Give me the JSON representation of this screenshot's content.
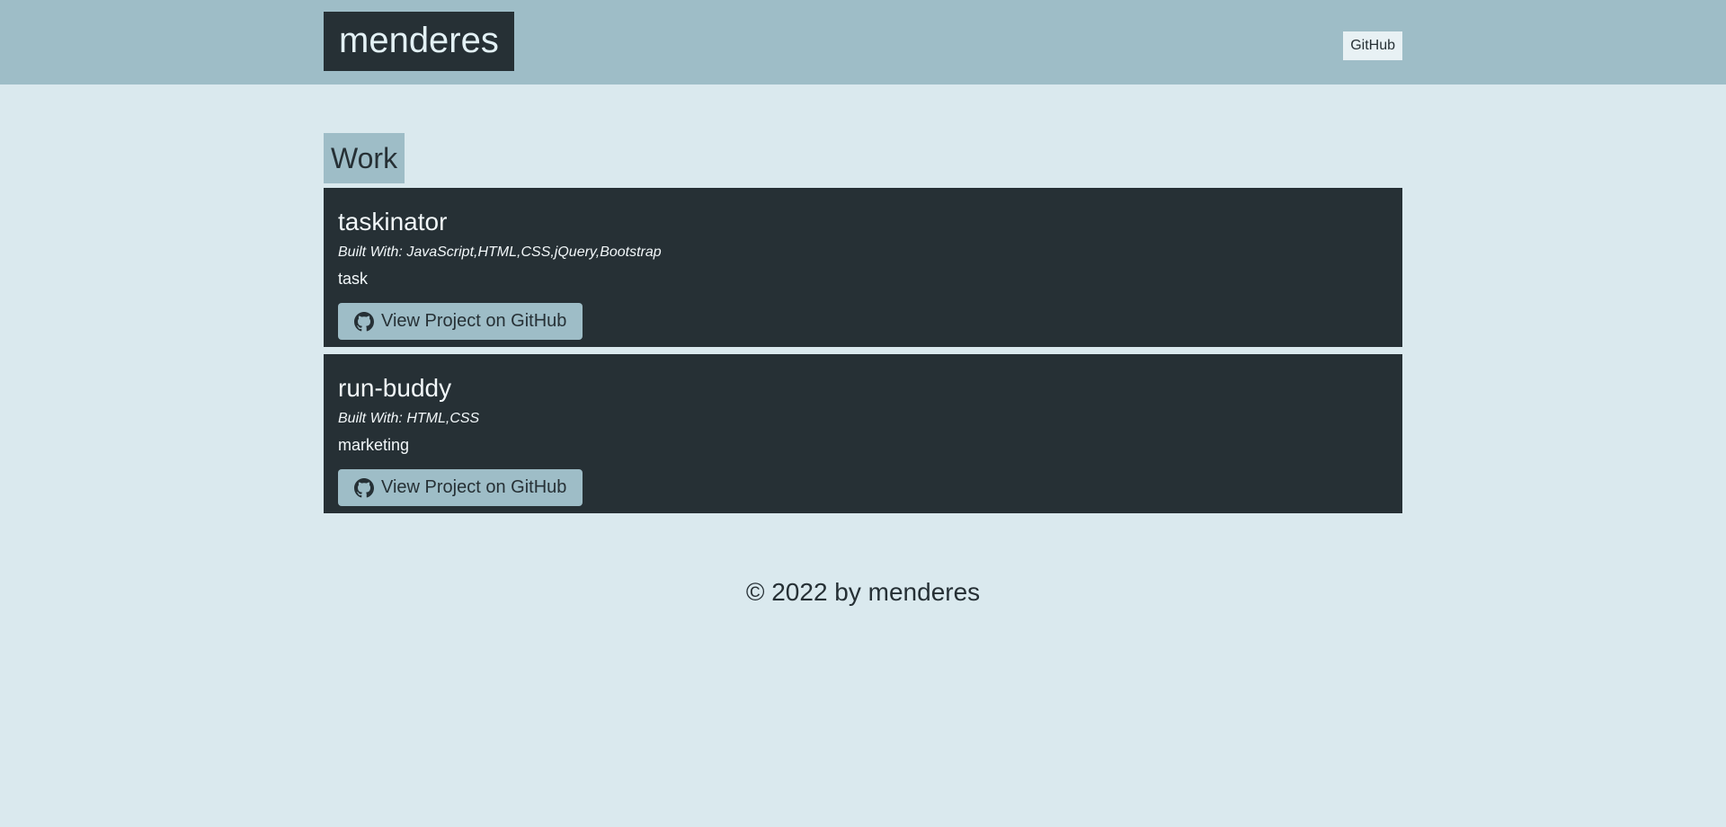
{
  "header": {
    "brand": "menderes",
    "nav_github": "GitHub"
  },
  "work": {
    "title": "Work",
    "projects": [
      {
        "name": "taskinator",
        "built_with": "Built With: JavaScript,HTML,CSS,jQuery,Bootstrap",
        "description": "task",
        "button_label": "View Project on GitHub",
        "icon": "github-icon"
      },
      {
        "name": "run-buddy",
        "built_with": "Built With: HTML,CSS",
        "description": "marketing",
        "button_label": "View Project on GitHub",
        "icon": "github-icon"
      }
    ]
  },
  "footer": {
    "text": "© 2022 by menderes"
  },
  "colors": {
    "background": "#dae9ee",
    "header": "#9ebdc7",
    "dark": "#263035"
  }
}
